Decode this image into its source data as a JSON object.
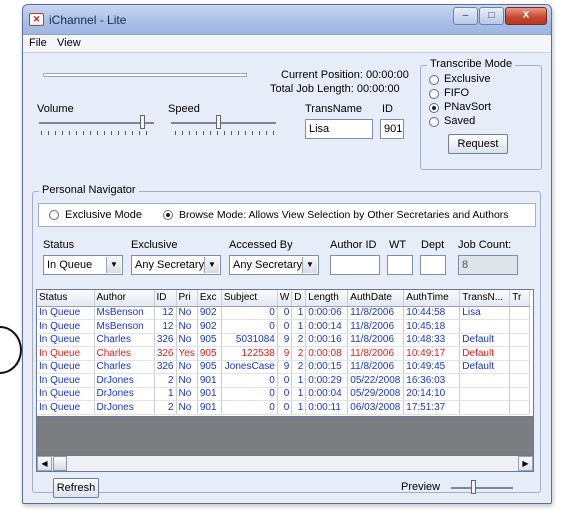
{
  "window": {
    "title": "iChannel - Lite",
    "app_icon": "ichannel-logo-icon",
    "controls": {
      "minimize": "–",
      "maximize": "□",
      "close": "X"
    }
  },
  "menu": {
    "file": "File",
    "view": "View"
  },
  "transport": {
    "current_position_label": "Current Position:",
    "current_position_value": "00:00:00",
    "total_job_length_label": "Total Job Length:",
    "total_job_length_value": "00:00:00",
    "volume_label": "Volume",
    "speed_label": "Speed",
    "volume_level": 0.92,
    "speed_level": 0.45
  },
  "trans": {
    "name_label": "TransName",
    "id_label": "ID",
    "name_value": "Lisa",
    "id_value": "901"
  },
  "transcribe_mode": {
    "title": "Transcribe Mode",
    "options": [
      "Exclusive",
      "FIFO",
      "PNavSort",
      "Saved"
    ],
    "selected": "PNavSort",
    "request_button": "Request"
  },
  "navigator": {
    "title": "Personal Navigator",
    "exclusive_mode": "Exclusive Mode",
    "browse_mode": "Browse Mode:  Allows View Selection by Other Secretaries and Authors",
    "selected_mode": "Browse Mode"
  },
  "filters": {
    "status_label": "Status",
    "status_value": "In Queue",
    "exclusive_label": "Exclusive",
    "exclusive_value": "Any Secretary",
    "accessed_by_label": "Accessed By",
    "accessed_by_value": "Any Secretary",
    "author_id_label": "Author ID",
    "author_id_value": "",
    "wt_label": "WT",
    "wt_value": "",
    "dept_label": "Dept",
    "dept_value": "",
    "job_count_label": "Job Count:",
    "job_count_value": "8"
  },
  "table": {
    "columns": [
      "Status",
      "Author",
      "ID",
      "Pri",
      "Exc",
      "Subject",
      "W",
      "D",
      "Length",
      "AuthDate",
      "AuthTime",
      "TransN...",
      "Tr"
    ],
    "rows": [
      {
        "color": "blue",
        "cells": [
          "In Queue",
          "MsBenson",
          "12",
          "No",
          "902",
          "0",
          "0",
          "1",
          "0:00:06",
          "11/8/2006",
          "10:44:58",
          "Lisa",
          ""
        ]
      },
      {
        "color": "blue",
        "cells": [
          "In Queue",
          "MsBenson",
          "12",
          "No",
          "902",
          "0",
          "0",
          "1",
          "0:00:14",
          "11/8/2006",
          "10:45:18",
          "",
          ""
        ]
      },
      {
        "color": "blue",
        "cells": [
          "In Queue",
          "Charles",
          "326",
          "No",
          "905",
          "5031084",
          "9",
          "2",
          "0:00:16",
          "11/8/2006",
          "10:48:33",
          "Default",
          ""
        ]
      },
      {
        "color": "red",
        "cells": [
          "In Queue",
          "Charles",
          "326",
          "Yes",
          "905",
          "122538",
          "9",
          "2",
          "0:00:08",
          "11/8/2006",
          "10:49:17",
          "Default",
          ""
        ]
      },
      {
        "color": "blue",
        "cells": [
          "In Queue",
          "Charles",
          "326",
          "No",
          "905",
          "JonesCase",
          "9",
          "2",
          "0:00:15",
          "11/8/2006",
          "10:49:45",
          "Default",
          ""
        ]
      },
      {
        "color": "blue",
        "cells": [
          "In Queue",
          "DrJones",
          "2",
          "No",
          "901",
          "0",
          "0",
          "1",
          "0:00:29",
          "05/22/2008",
          "16:36:03",
          "",
          ""
        ]
      },
      {
        "color": "blue",
        "cells": [
          "In Queue",
          "DrJones",
          "1",
          "No",
          "901",
          "0",
          "0",
          "1",
          "0:00:04",
          "05/29/2008",
          "20:14:10",
          "",
          ""
        ]
      },
      {
        "color": "blue",
        "cells": [
          "In Queue",
          "DrJones",
          "2",
          "No",
          "901",
          "0",
          "0",
          "1",
          "0:00:11",
          "06/03/2008",
          "17:51:37",
          "",
          ""
        ]
      }
    ]
  },
  "bottom": {
    "refresh_button": "Refresh",
    "preview_label": "Preview",
    "preview_level": 0.35
  },
  "colors": {
    "queue_blue": "#1836c8",
    "priority_red": "#e31c1c"
  }
}
